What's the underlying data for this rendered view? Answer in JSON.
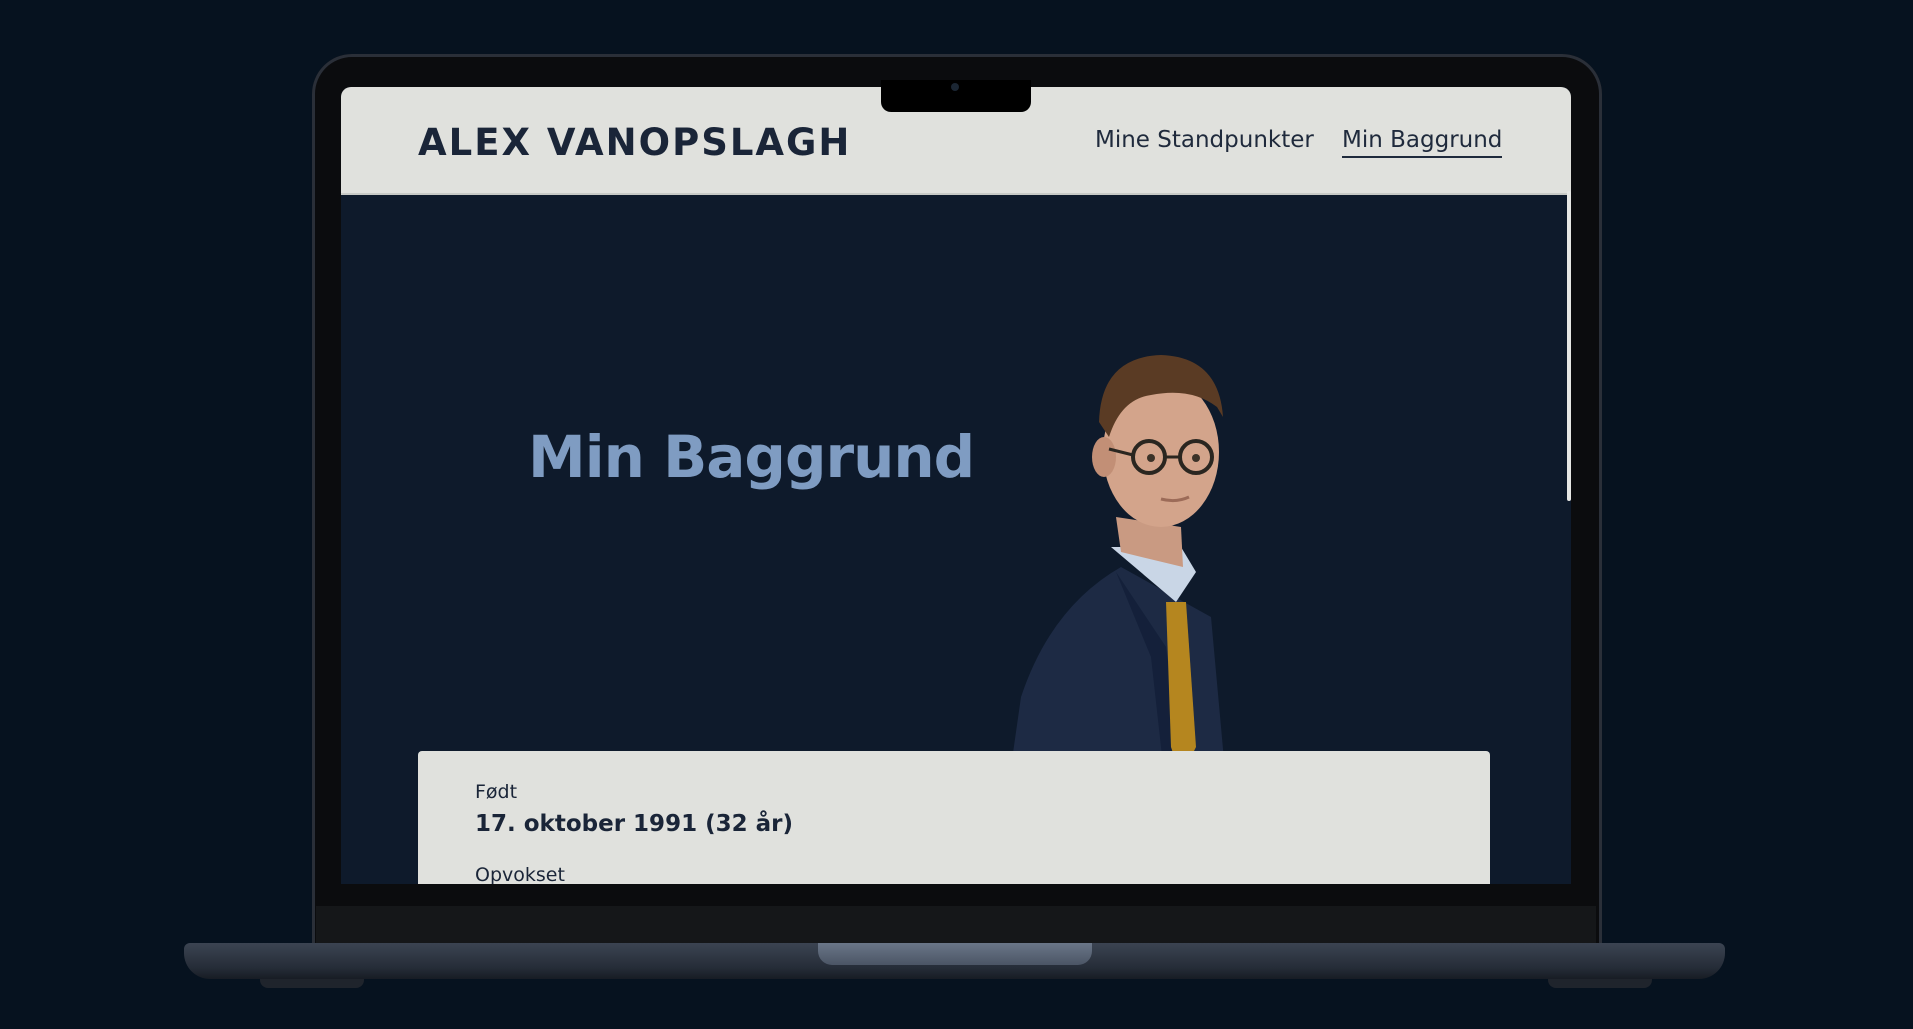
{
  "site": {
    "brand": "ALEX VANOPSLAGH",
    "nav": [
      {
        "label": "Mine Standpunkter",
        "active": false
      },
      {
        "label": "Min Baggrund",
        "active": true
      }
    ]
  },
  "hero": {
    "title": "Min Baggrund"
  },
  "card": {
    "born_label": "Født",
    "born_value": "17. oktober 1991 (32 år)",
    "next_label": "Opvokset"
  },
  "colors": {
    "page_bg": "#06121f",
    "screen_bg": "#0e1a2b",
    "header_bg": "#e0e1dd",
    "title_accent": "#7f9cc2",
    "text_dark": "#1a2538"
  }
}
